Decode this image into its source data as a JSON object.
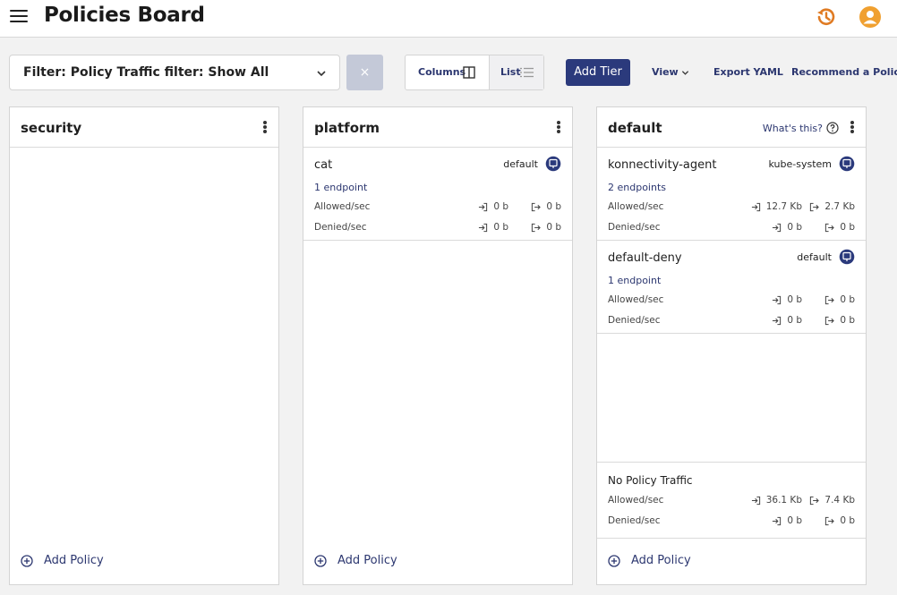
{
  "header": {
    "title": "Policies Board"
  },
  "toolbar": {
    "filter_label": "Filter: Policy Traffic filter: Show All",
    "clear_symbol": "×",
    "columns_label": "Columns",
    "list_label": "List",
    "add_tier_label": "Add Tier",
    "view_label": "View",
    "export_label": "Export YAML",
    "recommend_label": "Recommend a Policy"
  },
  "colors": {
    "accent": "#2b3a7c",
    "user_icon": "#f0a030",
    "history_icon": "#e07b23"
  },
  "labels": {
    "allowed": "Allowed/sec",
    "denied": "Denied/sec",
    "add_policy": "Add Policy",
    "whats_this": "What's this?"
  },
  "columns": [
    {
      "title": "security",
      "cards": []
    },
    {
      "title": "platform",
      "cards": [
        {
          "name": "cat",
          "namespace": "default",
          "endpoints": "1 endpoint",
          "allowed_in": "0 b",
          "allowed_out": "0 b",
          "denied_in": "0 b",
          "denied_out": "0 b"
        }
      ]
    },
    {
      "title": "default",
      "cards": [
        {
          "name": "konnectivity-agent",
          "namespace": "kube-system",
          "endpoints": "2 endpoints",
          "allowed_in": "12.7 Kb",
          "allowed_out": "2.7 Kb",
          "denied_in": "0 b",
          "denied_out": "0 b"
        },
        {
          "name": "default-deny",
          "namespace": "default",
          "endpoints": "1 endpoint",
          "allowed_in": "0 b",
          "allowed_out": "0 b",
          "denied_in": "0 b",
          "denied_out": "0 b"
        }
      ],
      "no_policy_traffic": {
        "title": "No Policy Traffic",
        "allowed_in": "36.1 Kb",
        "allowed_out": "7.4 Kb",
        "denied_in": "0 b",
        "denied_out": "0 b"
      }
    }
  ]
}
